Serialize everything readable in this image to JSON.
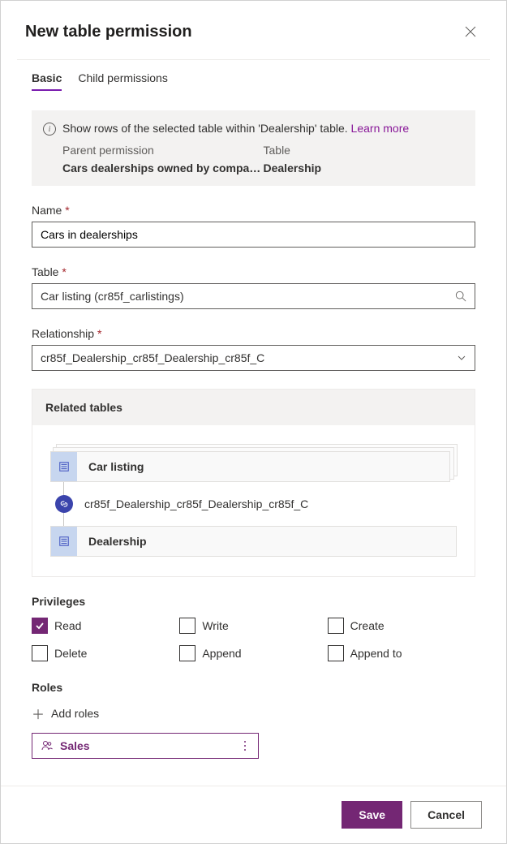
{
  "header": {
    "title": "New table permission"
  },
  "tabs": {
    "basic": "Basic",
    "child": "Child permissions"
  },
  "info": {
    "text": "Show rows of the selected table within 'Dealership' table.",
    "learn_more": "Learn more",
    "parent_label": "Parent permission",
    "table_label": "Table",
    "parent_value": "Cars dealerships owned by compa…",
    "table_value": "Dealership"
  },
  "fields": {
    "name_label": "Name",
    "name_value": "Cars in dealerships",
    "table_label": "Table",
    "table_value": "Car listing (cr85f_carlistings)",
    "relationship_label": "Relationship",
    "relationship_value": "cr85f_Dealership_cr85f_Dealership_cr85f_C"
  },
  "related": {
    "heading": "Related tables",
    "card1": "Car listing",
    "relation": "cr85f_Dealership_cr85f_Dealership_cr85f_C",
    "card2": "Dealership"
  },
  "privileges": {
    "heading": "Privileges",
    "read": "Read",
    "write": "Write",
    "create": "Create",
    "delete": "Delete",
    "append": "Append",
    "append_to": "Append to"
  },
  "roles": {
    "heading": "Roles",
    "add": "Add roles",
    "role1": "Sales"
  },
  "footer": {
    "save": "Save",
    "cancel": "Cancel"
  }
}
